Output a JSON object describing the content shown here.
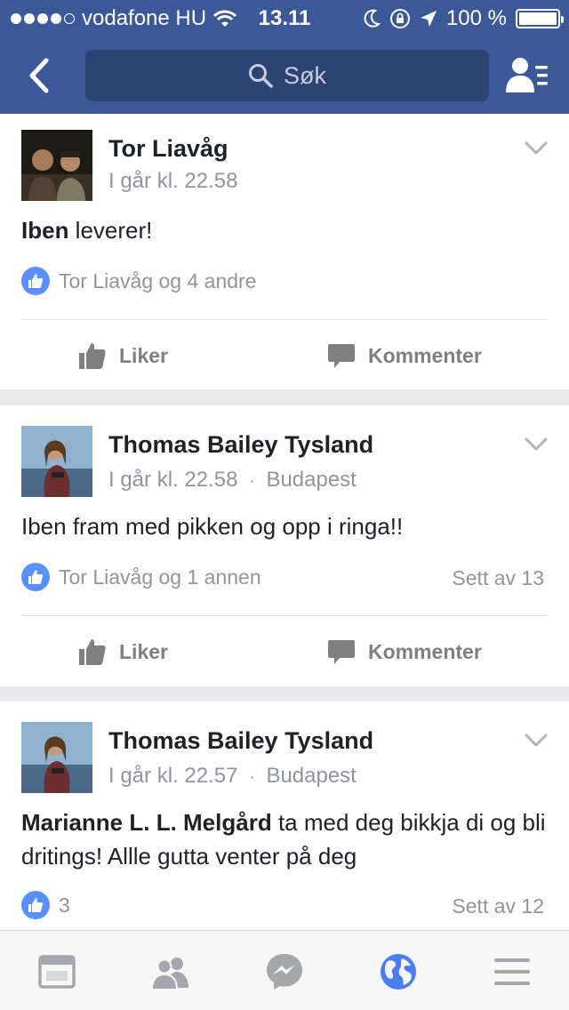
{
  "status_bar": {
    "carrier": "vodafone HU",
    "time": "13.11",
    "battery": "100 %"
  },
  "nav": {
    "search_placeholder": "Søk"
  },
  "posts": [
    {
      "author": "Tor Liavåg",
      "timestamp": "I går kl. 22.58",
      "location": "",
      "mention": "Iben",
      "text": " leverer!",
      "likes_text": "Tor Liavåg og 4 andre",
      "seen_text": "",
      "like_label": "Liker",
      "comment_label": "Kommenter"
    },
    {
      "author": "Thomas Bailey Tysland",
      "timestamp": "I går kl. 22.58",
      "separator": "·",
      "location": "Budapest",
      "mention": "",
      "text": "Iben fram med pikken og opp i ringa!!",
      "likes_text": "Tor Liavåg og 1 annen",
      "seen_text": "Sett av 13",
      "like_label": "Liker",
      "comment_label": "Kommenter"
    },
    {
      "author": "Thomas Bailey Tysland",
      "timestamp": "I går kl. 22.57",
      "separator": "·",
      "location": "Budapest",
      "mention": "Marianne L. L. Melgård",
      "text": " ta med deg bikkja di og bli dritings! Allle gutta venter på deg",
      "likes_text": "3",
      "seen_text": "Sett av 12"
    }
  ],
  "tabbar": {
    "tabs": [
      "news-feed",
      "friend-requests",
      "messenger",
      "notifications",
      "more"
    ],
    "active": "notifications"
  },
  "colors": {
    "brand": "#3b5998",
    "like_blue": "#5890ff",
    "active_tab": "#4a7ef0",
    "inactive_tab": "#a4a7ad"
  }
}
